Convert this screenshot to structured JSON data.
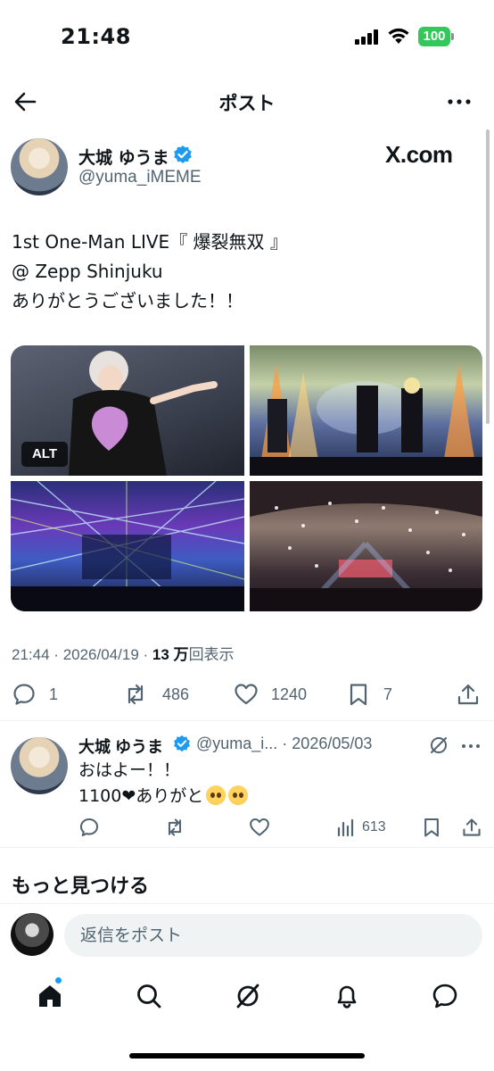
{
  "status_bar": {
    "time": "21:48",
    "battery": "100",
    "battery_color": "#34c759"
  },
  "header": {
    "title": "ポスト",
    "back_icon": "arrow-left-icon",
    "more_icon": "more-horizontal-icon"
  },
  "post": {
    "author_name": "大城 ゆうま",
    "handle": "@yuma_iMEME",
    "verified": true,
    "brand": "X.com",
    "text_lines": [
      "1st One-Man LIVE『 爆裂無双 』",
      "@ Zepp Shinjuku",
      "ありがとうございました！！"
    ],
    "media": {
      "count": 4,
      "alt_badge": "ALT"
    },
    "time": "21:44",
    "separator": "·",
    "date": "2026/04/19",
    "views_count": "13 万",
    "views_label": "回表示",
    "stats": {
      "replies": "1",
      "reposts": "486",
      "likes": "1240",
      "bookmarks": "7"
    }
  },
  "reply": {
    "author_name": "大城 ゆうま",
    "handle_date": "@yuma_i... · 2026/05/03",
    "text_line1": "おはよー！！",
    "text_line2": "1100❤ありがと",
    "views": "613"
  },
  "discover": {
    "title": "もっと見つける"
  },
  "composer": {
    "placeholder": "返信をポスト"
  },
  "colors": {
    "accent": "#1d9bf0",
    "text_primary": "#0f1419",
    "text_secondary": "#536471",
    "divider": "#eff3f4"
  },
  "tabbar": {
    "items": [
      "home-icon",
      "search-icon",
      "grok-icon",
      "notifications-icon",
      "messages-icon"
    ]
  }
}
